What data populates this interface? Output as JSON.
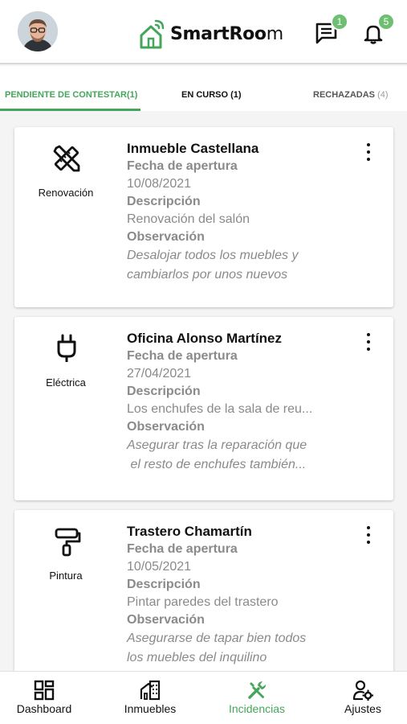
{
  "header": {
    "logo_bold": "SmartRoo",
    "logo_light": "m",
    "messages_badge": "1",
    "notifications_badge": "5"
  },
  "tabs": [
    {
      "label": "PENDIENTE DE CONTESTAR(1)",
      "active": true
    },
    {
      "label": "EN CURSO (1)"
    },
    {
      "label": "RECHAZADAS",
      "count": "(4)"
    }
  ],
  "labels": {
    "fecha": "Fecha de apertura",
    "descripcion": "Descripción",
    "observacion": "Observación"
  },
  "cards": [
    {
      "category": "Renovación",
      "icon": "ruler-pencil-icon",
      "title": "Inmueble Castellana",
      "fecha": "10/08/2021",
      "descripcion": "Renovación del salón",
      "observacion_1": "Desalojar todos los muebles y",
      "observacion_2": "cambiarlos por unos nuevos"
    },
    {
      "category": "Eléctrica",
      "icon": "plug-icon",
      "title": "Oficina Alonso Martínez",
      "fecha": "27/04/2021",
      "descripcion": "Los enchufes de la sala de reu...",
      "observacion_1": "Asegurar tras la reparación que",
      "observacion_2": " el resto de enchufes también..."
    },
    {
      "category": "Pintura",
      "icon": "paint-roller-icon",
      "title": "Trastero Chamartín",
      "fecha": "10/05/2021",
      "descripcion": "Pintar paredes del trastero",
      "observacion_1": "Asegurarse de tapar bien todos",
      "observacion_2": "los muebles del inquilino"
    }
  ],
  "bottom_nav": [
    {
      "label": "Dashboard",
      "icon": "dashboard-icon"
    },
    {
      "label": "Inmuebles",
      "icon": "building-icon"
    },
    {
      "label": "Incidencias",
      "icon": "tools-icon",
      "active": true
    },
    {
      "label": "Ajustes",
      "icon": "user-settings-icon"
    }
  ],
  "colors": {
    "accent": "#45a55a",
    "badge": "#6fbf73",
    "muted_text": "#8a8a8a"
  }
}
